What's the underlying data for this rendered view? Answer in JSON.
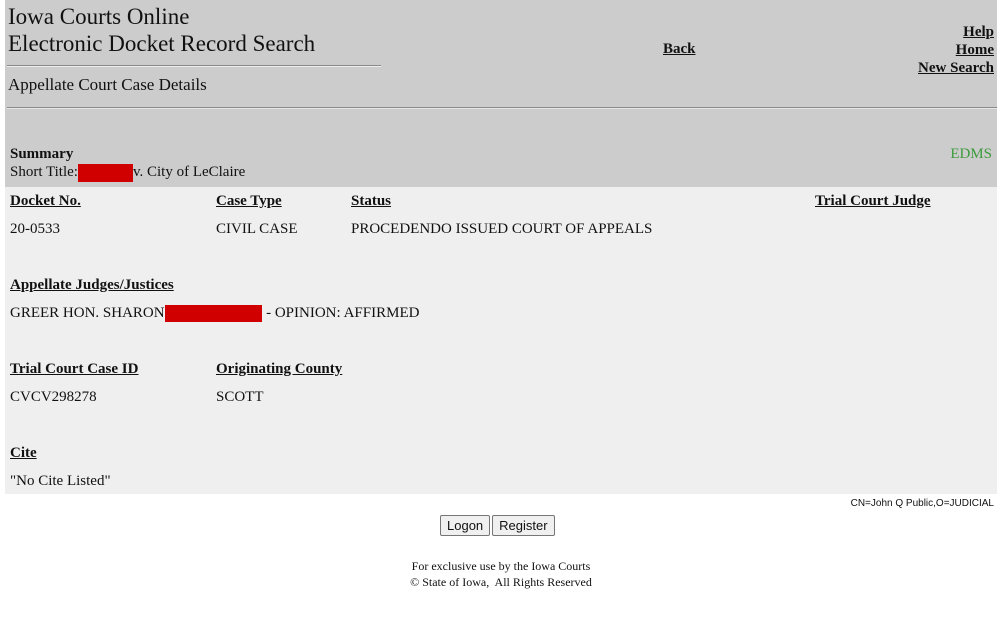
{
  "header": {
    "title_line1": "Iowa Courts Online",
    "title_line2": "Electronic Docket Record Search",
    "subtitle": "Appellate Court Case Details",
    "nav": {
      "back": "Back",
      "help": "Help",
      "home": "Home",
      "new_search": "New Search"
    }
  },
  "summary": {
    "label": "Summary",
    "short_title_label": "Short Title:",
    "short_title_suffix": "v. City of LeClaire",
    "edms_link": "EDMS"
  },
  "details": {
    "docket_no": {
      "label": "Docket No.",
      "value": "20-0533"
    },
    "case_type": {
      "label": "Case Type",
      "value": "CIVIL CASE"
    },
    "status": {
      "label": "Status",
      "value": "PROCEDENDO ISSUED COURT OF APPEALS"
    },
    "trial_court_judge": {
      "label": "Trial Court Judge",
      "value": ""
    },
    "appellate_judges": {
      "label": "Appellate Judges/Justices",
      "name_prefix": "GREER HON. SHARON",
      "suffix": "- OPINION: AFFIRMED"
    },
    "trial_court_case_id": {
      "label": "Trial Court Case ID",
      "value": "CVCV298278"
    },
    "originating_county": {
      "label": "Originating County",
      "value": "SCOTT"
    },
    "cite": {
      "label": "Cite",
      "value": "\"No Cite Listed\""
    }
  },
  "user_info": "CN=John Q Public,O=JUDICIAL",
  "buttons": {
    "logon": "Logon",
    "register": "Register"
  },
  "footer": {
    "line1": "For exclusive use by the Iowa Courts",
    "line2": "© State of Iowa,  All Rights Reserved"
  },
  "colors": {
    "header_bg": "#cccccc",
    "details_bg": "#efefef",
    "edms_green": "#3c9a3c",
    "redaction_red": "#d10000"
  }
}
